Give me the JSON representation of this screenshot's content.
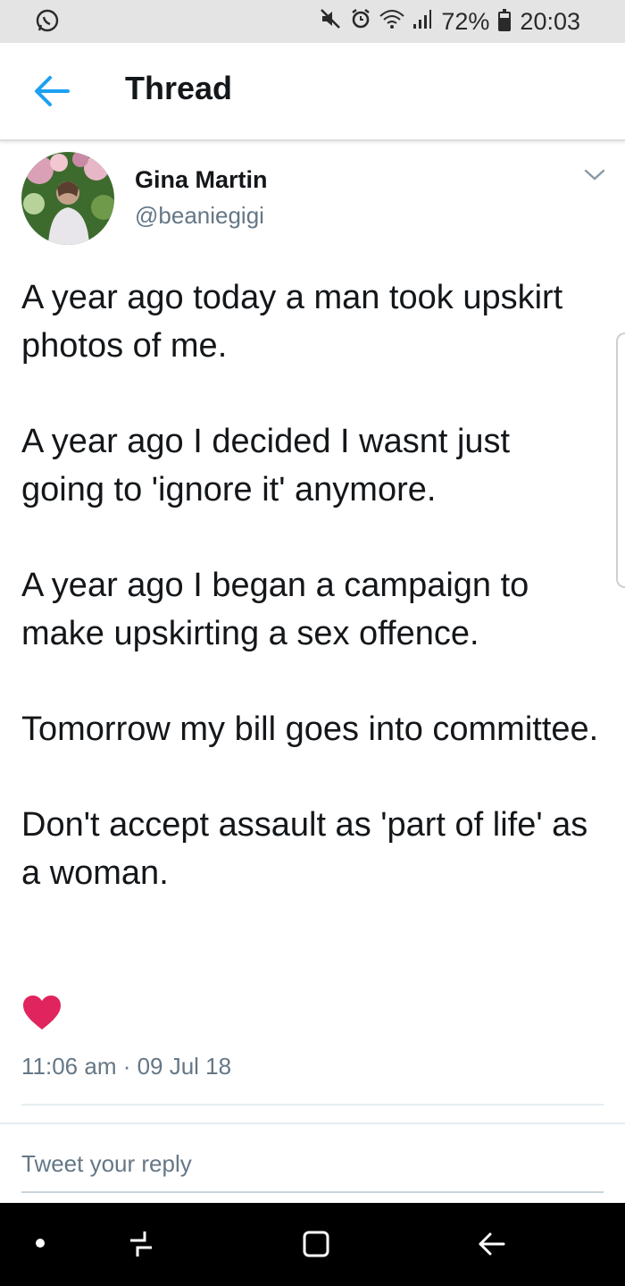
{
  "status_bar": {
    "battery_percent": "72%",
    "battery_level": 0.72,
    "time": "20:03",
    "icons": [
      "whatsapp-icon",
      "mute-icon",
      "alarm-icon",
      "wifi-icon",
      "signal-icon",
      "battery-icon"
    ]
  },
  "header": {
    "title": "Thread",
    "back_icon": "back-arrow-icon"
  },
  "tweet": {
    "author_name": "Gina Martin",
    "author_handle": "@beaniegigi",
    "paragraphs": [
      "A year ago today a man took upskirt photos of me.",
      "A year ago I decided I wasnt just going to 'ignore it' anymore.",
      "A year ago I began a campaign to make upskirting a sex offence.",
      "Tomorrow my bill goes into committee.",
      "Don't accept assault as 'part of life' as a woman."
    ],
    "timestamp": "11:06 am · 09 Jul 18",
    "like_icon": "heart-icon",
    "like_color": "#e0245e"
  },
  "reply": {
    "placeholder": "Tweet your reply"
  },
  "nav_bar": {
    "icons": [
      "dot-icon",
      "recents-icon",
      "home-icon",
      "back-icon"
    ]
  },
  "colors": {
    "accent": "#1da1f2",
    "secondary_text": "#657786",
    "status_bar_bg": "#e4e4e4"
  }
}
